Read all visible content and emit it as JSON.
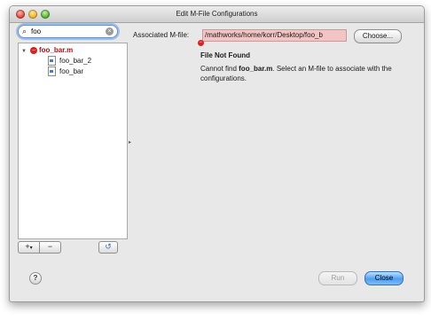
{
  "window": {
    "title": "Edit M-File Configurations"
  },
  "search": {
    "value": "foo",
    "placeholder": ""
  },
  "tree": {
    "parent": {
      "label": "foo_bar.m",
      "status": "error"
    },
    "children": [
      {
        "label": "foo_bar_2"
      },
      {
        "label": "foo_bar"
      }
    ]
  },
  "tree_buttons": {
    "add": "+",
    "add_arrow": "▾",
    "remove": "−",
    "refresh": "↺"
  },
  "association": {
    "label": "Associated M-file:",
    "value": "/mathworks/home/korr/Desktop/foo_b",
    "choose_label": "Choose..."
  },
  "not_found": {
    "title": "File Not Found",
    "msg_prefix": "Cannot find ",
    "msg_file": "foo_bar.m",
    "msg_suffix": ". Select an M-file to associate with the configurations."
  },
  "footer": {
    "help": "?",
    "run": "Run",
    "close": "Close"
  },
  "colors": {
    "error": "#dd2222",
    "default_button": "#4f9ff0",
    "field_error_bg": "#f2c4c4"
  }
}
